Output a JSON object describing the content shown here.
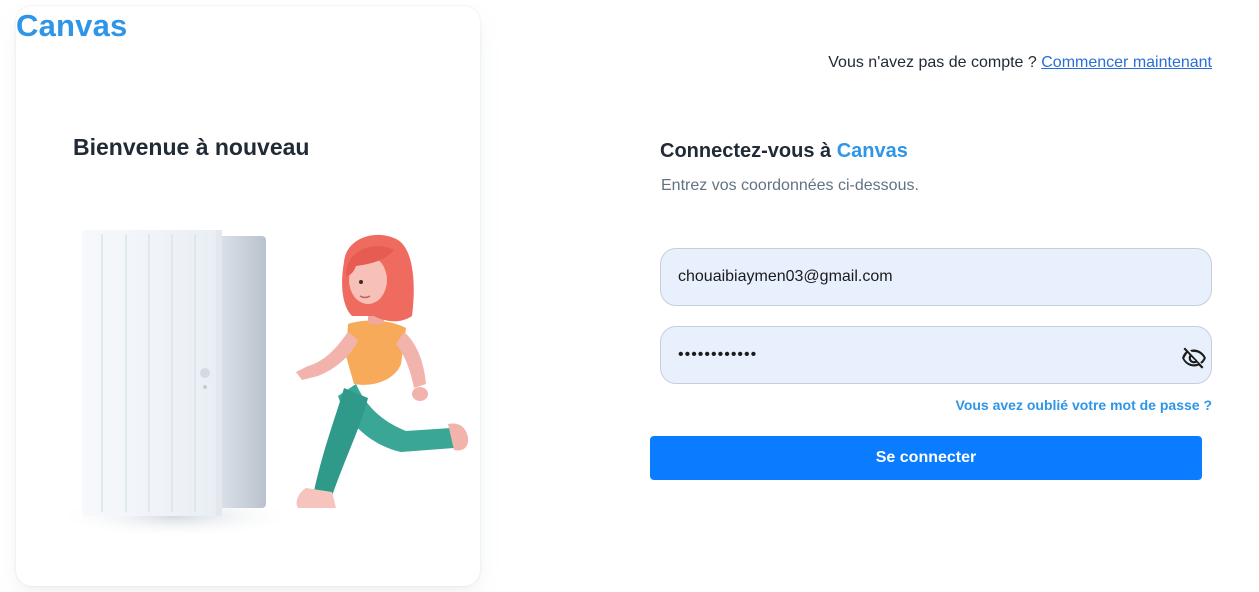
{
  "brand": {
    "name": "Canvas",
    "color": "#2f95e6"
  },
  "welcome": {
    "title": "Bienvenue à nouveau"
  },
  "illustration": {
    "icon": "person-running-through-door-illustration"
  },
  "signup": {
    "prompt": "Vous n'avez pas de compte ?",
    "link_label": "Commencer maintenant"
  },
  "form": {
    "title_prefix": "Connectez-vous à",
    "title_accent": "Canvas",
    "subtitle": "Entrez vos coordonnées ci-dessous.",
    "email_value": "chouaibiaymen03@gmail.com",
    "password_value": "••••••••••••",
    "password_toggle_icon": "eye-off-icon",
    "forgot_label": "Vous avez oublié votre mot de passe ?",
    "submit_label": "Se connecter"
  },
  "colors": {
    "accent": "#2f95e6",
    "button": "#0a7cff",
    "input_bg": "#e8f0fe",
    "link": "#2a6fd6"
  }
}
